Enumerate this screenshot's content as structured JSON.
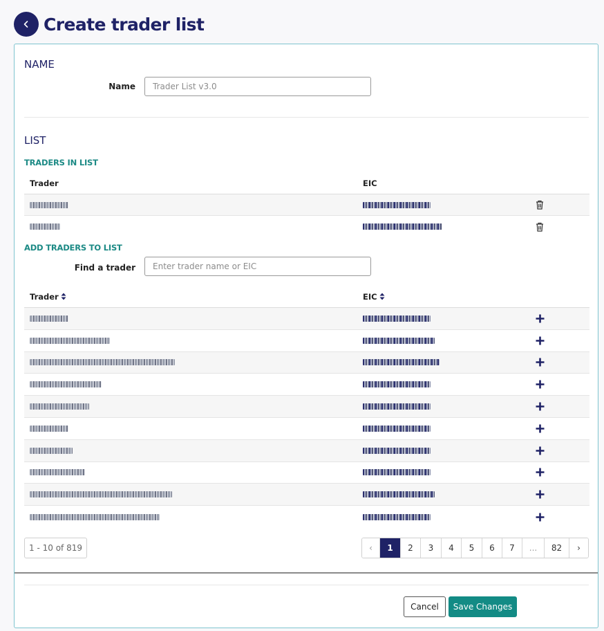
{
  "header": {
    "title": "Create trader list",
    "back_icon": "chevron-left-icon"
  },
  "name_section": {
    "title": "NAME",
    "label": "Name",
    "placeholder": "Trader List v3.0"
  },
  "list_section": {
    "title": "LIST",
    "traders_in_list_title": "TRADERS IN LIST",
    "columns": {
      "trader": "Trader",
      "eic": "EIC"
    },
    "rows": [
      {
        "trader": "BKW GmbH",
        "eic": "11XBKW-DE-----4",
        "action_icon": "trash-icon"
      },
      {
        "trader": "Trader",
        "eic": "10XEIC-CODE-VALUE-A",
        "action_icon": "trash-icon"
      }
    ],
    "add_title": "ADD TRADERS TO LIST",
    "find_label": "Find a trader",
    "find_placeholder": "Enter trader name or EIC",
    "add_columns": {
      "trader": "Trader",
      "eic": "EIC"
    },
    "add_rows": [
      {
        "trader": "BKW GmbH",
        "eic": "11XBKW-DE-----4",
        "action_icon": "plus-icon"
      },
      {
        "trader": "Switzerland Energy",
        "eic": "12XTRADER-CODE-2",
        "action_icon": "plus-icon"
      },
      {
        "trader": "AAA Energy and Commodities Trading Ltd",
        "eic": "10XAAA-ENERGY-TRD",
        "action_icon": "plus-icon"
      },
      {
        "trader": "ACE Trading GmbH",
        "eic": "11XACE-TRD-CODE",
        "action_icon": "plus-icon"
      },
      {
        "trader": "AE Energy Ltd",
        "eic": "10XAE-ENERGYLTD",
        "action_icon": "plus-icon"
      },
      {
        "trader": "BKW GmbH",
        "eic": "11XBKW-DE-----3",
        "action_icon": "plus-icon"
      },
      {
        "trader": "AERO GmbH",
        "eic": "11XAERO-GMBH-DE",
        "action_icon": "plus-icon"
      },
      {
        "trader": "Alpiq Spa AG",
        "eic": "12XALPIQ-SPA-CH",
        "action_icon": "plus-icon"
      },
      {
        "trader": "Axpo company for liquidation Inc.",
        "eic": "10XAXPO-COMP-LIQ",
        "action_icon": "plus-icon"
      },
      {
        "trader": "Axpo Solutions AG Zweigniederl",
        "eic": "11XAXPO-SOLUTNS",
        "action_icon": "plus-icon"
      }
    ],
    "pagination": {
      "summary": "1 - 10 of 819",
      "prev": "‹",
      "next": "›",
      "pages": [
        "1",
        "2",
        "3",
        "4",
        "5",
        "6",
        "7",
        "...",
        "82"
      ],
      "current": "1"
    }
  },
  "footer": {
    "cancel_label": "Cancel",
    "save_label": "Save Changes"
  },
  "colors": {
    "primary": "#1f2266",
    "accent": "#138b85",
    "card_border": "#7ec4cf"
  }
}
